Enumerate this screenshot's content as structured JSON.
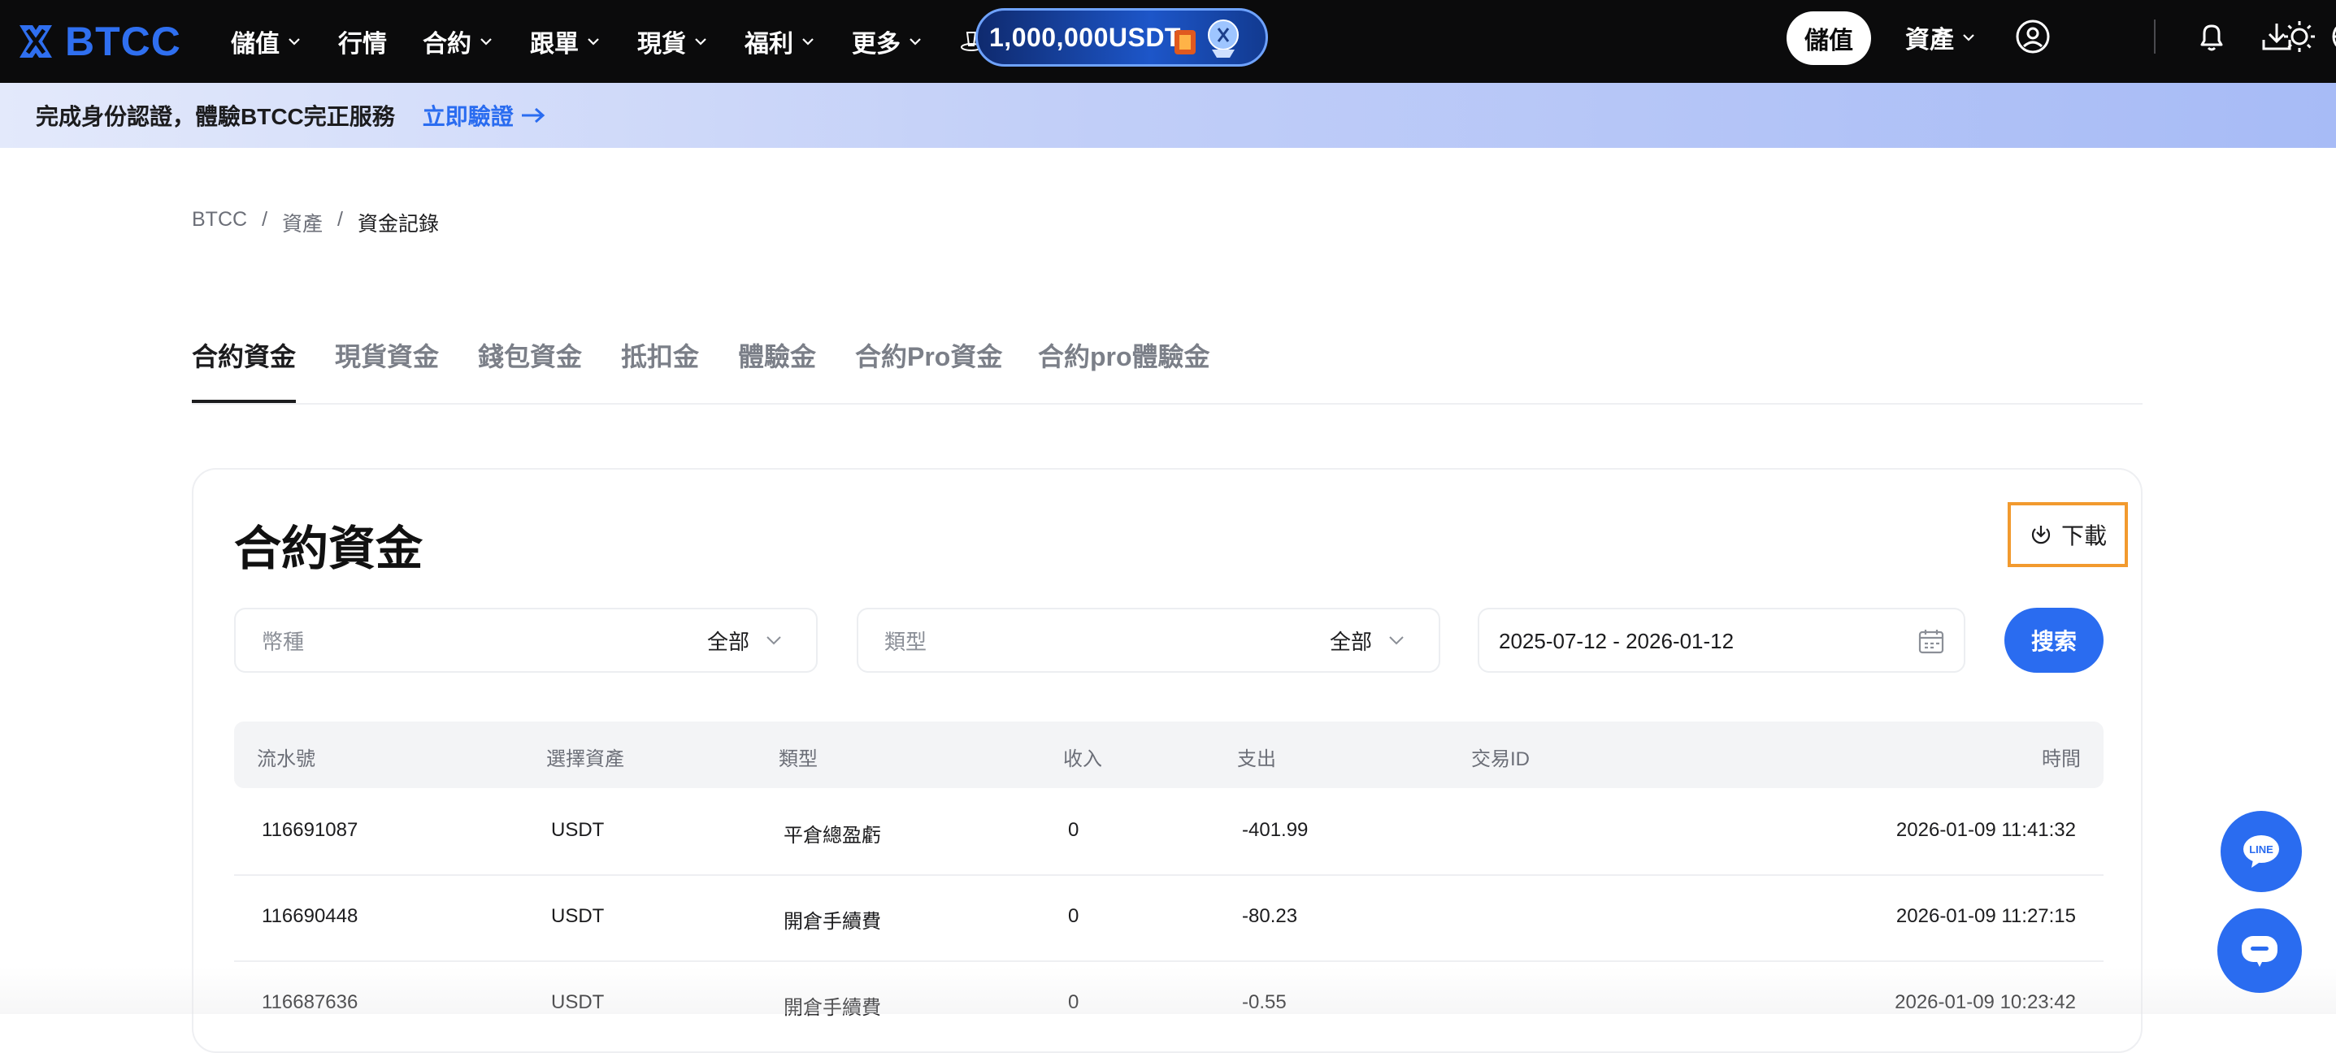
{
  "brand": {
    "name": "BTCC",
    "accent": "#2a6cf0"
  },
  "nav": {
    "items": [
      {
        "label": "儲值",
        "has_dropdown": true
      },
      {
        "label": "行情",
        "has_dropdown": false
      },
      {
        "label": "合約",
        "has_dropdown": true
      },
      {
        "label": "跟單",
        "has_dropdown": true
      },
      {
        "label": "現貨",
        "has_dropdown": true
      },
      {
        "label": "福利",
        "has_dropdown": true
      },
      {
        "label": "更多",
        "has_dropdown": true
      }
    ],
    "promo_label": "1,000,000USDT",
    "deposit_button": "儲值",
    "assets_label": "資產"
  },
  "banner": {
    "text": "完成身份認證，體驗BTCC完正服務",
    "link": "立即驗證"
  },
  "breadcrumb": {
    "root": "BTCC",
    "sep": "/",
    "level1": "資產",
    "current": "資金記錄"
  },
  "tabs": [
    {
      "label": "合約資金",
      "active": true
    },
    {
      "label": "現貨資金",
      "active": false
    },
    {
      "label": "錢包資金",
      "active": false
    },
    {
      "label": "抵扣金",
      "active": false
    },
    {
      "label": "體驗金",
      "active": false
    },
    {
      "label": "合約Pro資金",
      "active": false
    },
    {
      "label": "合約pro體驗金",
      "active": false
    }
  ],
  "card": {
    "title": "合約資金",
    "download_label": "下載",
    "filters": {
      "currency": {
        "label": "幣種",
        "value": "全部"
      },
      "type": {
        "label": "類型",
        "value": "全部"
      },
      "date_range": "2025-07-12 - 2026-01-12",
      "search_label": "搜索"
    },
    "table": {
      "columns": [
        "流水號",
        "選擇資產",
        "類型",
        "收入",
        "支出",
        "交易ID",
        "時間"
      ],
      "rows": [
        {
          "id": "116691087",
          "asset": "USDT",
          "type": "平倉總盈虧",
          "income": "0",
          "expense": "-401.99",
          "tx": "",
          "time": "2026-01-09 11:41:32"
        },
        {
          "id": "116690448",
          "asset": "USDT",
          "type": "開倉手續費",
          "income": "0",
          "expense": "-80.23",
          "tx": "",
          "time": "2026-01-09 11:27:15"
        },
        {
          "id": "116687636",
          "asset": "USDT",
          "type": "開倉手續費",
          "income": "0",
          "expense": "-0.55",
          "tx": "",
          "time": "2026-01-09 10:23:42"
        }
      ]
    }
  },
  "floating": {
    "line_label": "LINE"
  }
}
